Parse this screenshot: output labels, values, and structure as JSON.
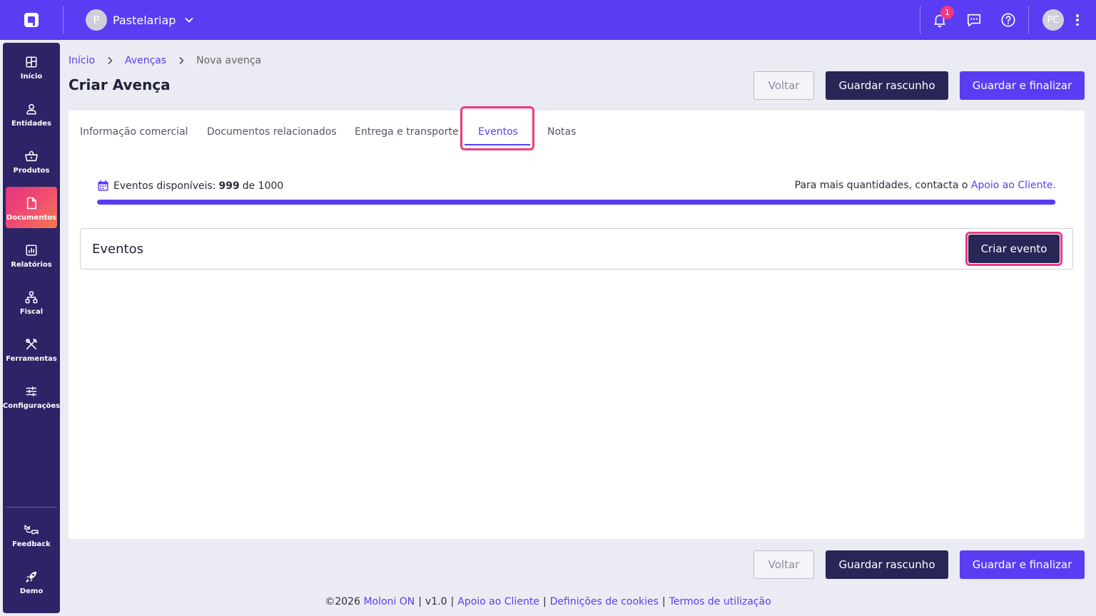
{
  "topbar": {
    "company_initial": "P",
    "company_name": "Pastelariap",
    "notification_count": "1",
    "user_initials": "PC"
  },
  "sidebar": {
    "items": [
      {
        "label": "Início",
        "icon": "dashboard-icon"
      },
      {
        "label": "Entidades",
        "icon": "user-icon"
      },
      {
        "label": "Produtos",
        "icon": "basket-icon"
      },
      {
        "label": "Documentos",
        "icon": "document-icon"
      },
      {
        "label": "Relatórios",
        "icon": "report-chart-icon"
      },
      {
        "label": "Fiscal",
        "icon": "fiscal-network-icon"
      },
      {
        "label": "Ferramentas",
        "icon": "tools-icon"
      },
      {
        "label": "Configurações",
        "icon": "sliders-icon"
      }
    ],
    "bottom_items": [
      {
        "label": "Feedback",
        "icon": "feedback-icon"
      },
      {
        "label": "Demo",
        "icon": "rocket-icon"
      }
    ],
    "active_index": 3
  },
  "breadcrumb": {
    "items": [
      "Início",
      "Avenças",
      "Nova avença"
    ]
  },
  "page": {
    "title": "Criar Avença"
  },
  "actions": {
    "back": "Voltar",
    "save_draft": "Guardar rascunho",
    "save_finish": "Guardar e finalizar"
  },
  "tabs": [
    {
      "label": "Informação comercial"
    },
    {
      "label": "Documentos relacionados"
    },
    {
      "label": "Entrega e transporte"
    },
    {
      "label": "Eventos"
    },
    {
      "label": "Notas"
    }
  ],
  "events_info": {
    "prefix": "Eventos disponíveis:",
    "available": "999",
    "of_label": "de 1000",
    "used_fraction": 0.999,
    "contact_text": "Para mais quantidades, contacta o",
    "contact_link": "Apoio ao Cliente."
  },
  "events_panel": {
    "title": "Eventos",
    "create_button": "Criar evento"
  },
  "footer": {
    "copyright": "©2026",
    "brand": "Moloni ON",
    "version": "v1.0",
    "support": "Apoio ao Cliente",
    "cookies": "Definições de cookies",
    "terms": "Termos de utilização"
  },
  "colors": {
    "brand": "#5a3cf3",
    "sidebar": "#2c2466",
    "dark_button": "#272656",
    "highlight": "#f0397f"
  }
}
